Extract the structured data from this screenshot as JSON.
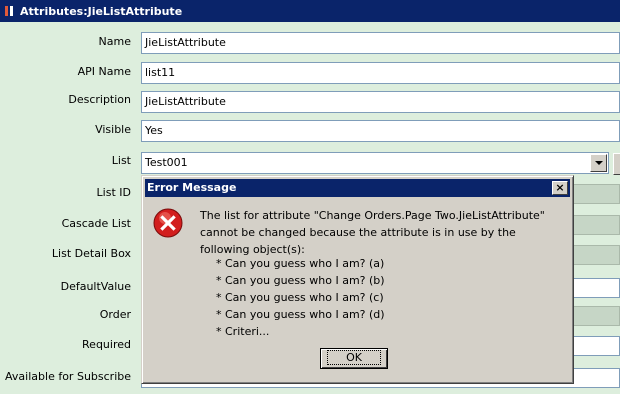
{
  "window": {
    "title": "Attributes:JieListAttribute"
  },
  "form": {
    "name_label": "Name",
    "name_value": "JieListAttribute",
    "api_name_label": "API Name",
    "api_name_value": "list11",
    "description_label": "Description",
    "description_value": "JieListAttribute",
    "visible_label": "Visible",
    "visible_value": "Yes",
    "list_label": "List",
    "list_value": "Test001",
    "list_id_label": "List ID",
    "cascade_list_label": "Cascade List",
    "list_detail_box_label": "List Detail Box",
    "default_value_label": "DefaultValue",
    "order_label": "Order",
    "required_label": "Required",
    "available_for_subscribe_label": "Available for Subscribe"
  },
  "dialog": {
    "title": "Error Message",
    "close_glyph": "×",
    "message": "The list for attribute \"Change Orders.Page Two.JieListAttribute\" cannot be changed because the attribute is in use by the following object(s):",
    "items": [
      "* Can you guess who I am? (a)",
      "* Can you guess who I am? (b)",
      "* Can you guess who I am? (c)",
      "* Can you guess who I am? (d)",
      "* Criteri..."
    ],
    "ok_label": "OK",
    "icon": "error-icon"
  },
  "colors": {
    "form_background": "#ddeedd",
    "titlebar": "#0a246a",
    "dialog_face": "#d4d0c8",
    "error_red": "#d21e1e"
  }
}
